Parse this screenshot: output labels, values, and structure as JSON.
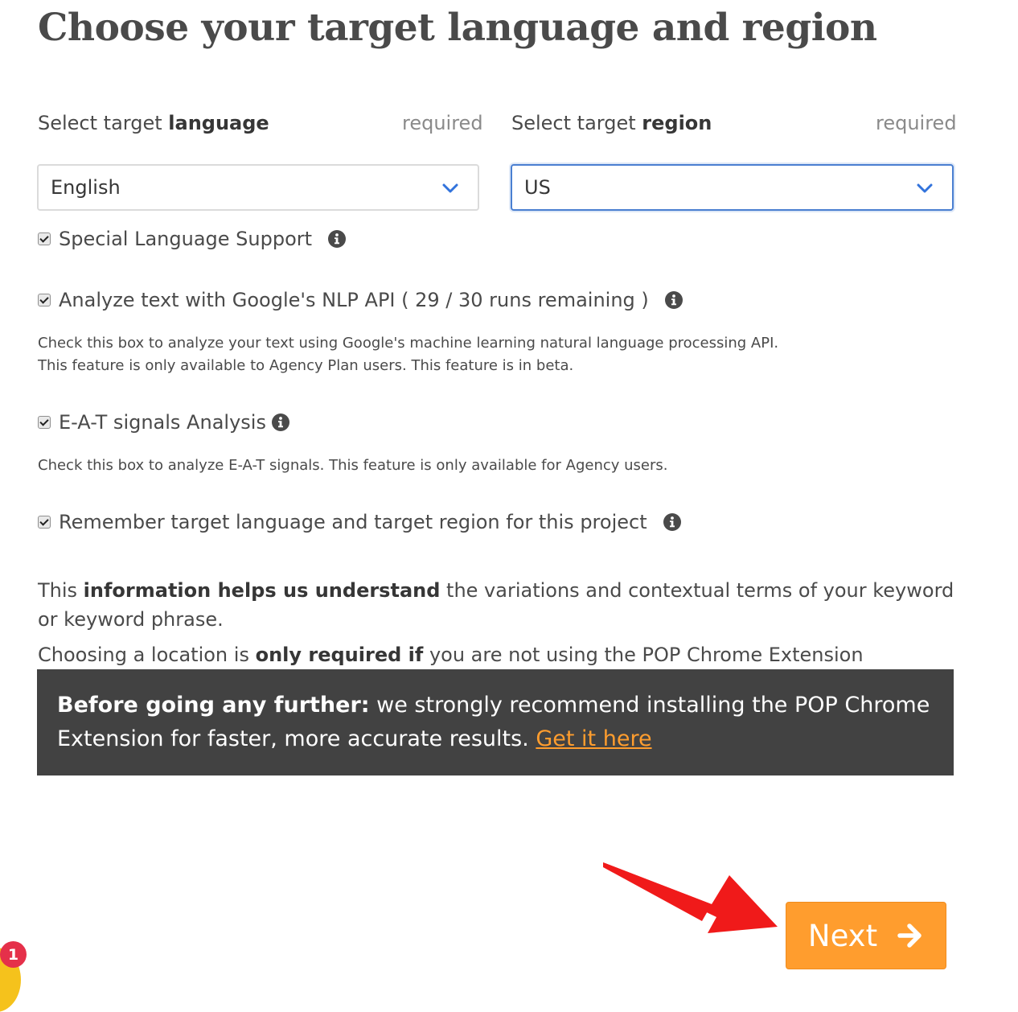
{
  "title": "Choose your target language and region",
  "language": {
    "label_prefix": "Select target ",
    "label_bold": "language",
    "required": "required",
    "value": "English"
  },
  "region": {
    "label_prefix": "Select target ",
    "label_bold": "region",
    "required": "required",
    "value": "US"
  },
  "options": {
    "special_language": {
      "label": "Special Language Support",
      "checked": true
    },
    "nlp": {
      "label": "Analyze text with Google's NLP API ( 29 / 30 runs remaining )",
      "checked": true,
      "help_line1": "Check this box to analyze your text using Google's machine learning natural language processing API.",
      "help_line2": "This feature is only available to Agency Plan users. This feature is in beta."
    },
    "eat": {
      "label": "E-A-T signals Analysis",
      "checked": true,
      "help": "Check this box to analyze E-A-T signals. This feature is only available for Agency users."
    },
    "remember": {
      "label": "Remember target language and target region for this project",
      "checked": true
    }
  },
  "description": {
    "p1_start": "This ",
    "p1_bold": "information helps us understand",
    "p1_end": " the variations and contextual terms of your keyword or keyword phrase.",
    "p2_start": "Choosing a location is ",
    "p2_bold": "only required if",
    "p2_end": " you are not using the POP Chrome Extension"
  },
  "banner": {
    "bold": "Before going any further:",
    "text": " we strongly recommend installing the POP Chrome Extension for faster, more accurate results. ",
    "link": "Get it here"
  },
  "next_button": {
    "label": "Next"
  },
  "notification": {
    "count": "1"
  },
  "colors": {
    "accent_orange": "#ff9d2e",
    "banner_bg": "#424242",
    "focus_blue": "#4a7fd1",
    "annotation_red": "#f01a1a",
    "badge_red": "#e5304a"
  },
  "icons": {
    "select_chevron": "chevron-down-icon",
    "info": "info-icon",
    "next": "arrow-right-icon",
    "annotation": "red-pointer-arrow"
  }
}
